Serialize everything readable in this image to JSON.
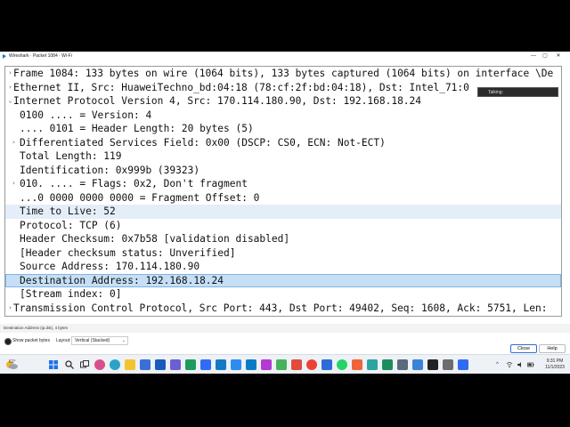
{
  "window": {
    "title": "Wireshark · Packet 1084 · Wi-Fi",
    "controls": {
      "minimize": "—",
      "maximize": "▢",
      "close": "✕"
    }
  },
  "tree": {
    "rows": [
      {
        "expander": "›",
        "text": "Frame 1084: 133 bytes on wire (1064 bits), 133 bytes captured (1064 bits) on interface \\De"
      },
      {
        "expander": "›",
        "text": "Ethernet II, Src: HuaweiTechno_bd:04:18 (78:cf:2f:bd:04:18), Dst: Intel_71:0"
      },
      {
        "expander": "⌄",
        "text": "Internet Protocol Version 4, Src: 170.114.180.90, Dst: 192.168.18.24"
      },
      {
        "expander": "",
        "text": "0100 .... = Version: 4"
      },
      {
        "expander": "",
        "text": ".... 0101 = Header Length: 20 bytes (5)"
      },
      {
        "expander": "›",
        "text": "Differentiated Services Field: 0x00 (DSCP: CS0, ECN: Not-ECT)"
      },
      {
        "expander": "",
        "text": "Total Length: 119"
      },
      {
        "expander": "",
        "text": "Identification: 0x999b (39323)"
      },
      {
        "expander": "›",
        "text": "010. .... = Flags: 0x2, Don't fragment"
      },
      {
        "expander": "",
        "text": "...0 0000 0000 0000 = Fragment Offset: 0"
      },
      {
        "expander": "",
        "text": "Time to Live: 52"
      },
      {
        "expander": "",
        "text": "Protocol: TCP (6)"
      },
      {
        "expander": "",
        "text": "Header Checksum: 0x7b58 [validation disabled]"
      },
      {
        "expander": "",
        "text": "[Header checksum status: Unverified]"
      },
      {
        "expander": "",
        "text": "Source Address: 170.114.180.90"
      },
      {
        "expander": "",
        "text": "Destination Address: 192.168.18.24"
      },
      {
        "expander": "",
        "text": "[Stream index: 0]"
      },
      {
        "expander": "›",
        "text": "Transmission Control Protocol, Src Port: 443, Dst Port: 49402, Seq: 1608, Ack: 5751, Len: "
      }
    ]
  },
  "popup": {
    "label": "Talking:"
  },
  "status": {
    "text": "Destination Address (ip.dst), 4 bytes"
  },
  "options": {
    "show_bytes_label": "Show packet bytes",
    "layout_label": "Layout:",
    "layout_value": "Vertical (Stacked)",
    "close_label": "Close",
    "help_label": "Help"
  },
  "taskbar": {
    "weather": "61°",
    "time": "9:31 PM",
    "date": "11/1/2023"
  },
  "colors": {
    "selection": "#c6dff5",
    "selection_border": "#7eb4ea",
    "taskbar": "#eef1f6"
  }
}
